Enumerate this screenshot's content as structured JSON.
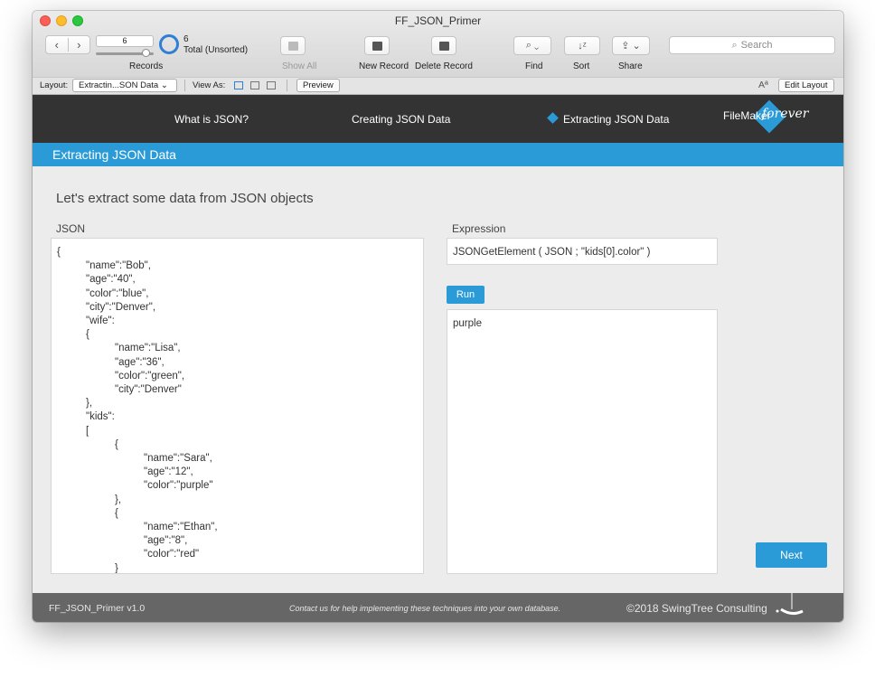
{
  "window": {
    "title": "FF_JSON_Primer"
  },
  "toolbar": {
    "record_number": "6",
    "records_label": "Records",
    "found_count": "6",
    "found_total": "Total (Unsorted)",
    "show_all": "Show All",
    "new_record": "New Record",
    "delete_record": "Delete Record",
    "find": "Find",
    "sort": "Sort",
    "share": "Share",
    "search_placeholder": "Search"
  },
  "layout_bar": {
    "layout_label": "Layout:",
    "layout_value": "Extractin...SON Data",
    "view_as_label": "View As:",
    "preview": "Preview",
    "edit_layout": "Edit Layout",
    "font_size_icon": "Aª"
  },
  "nav": {
    "items": [
      {
        "label": "What is JSON?"
      },
      {
        "label": "Creating JSON Data"
      },
      {
        "label": "Extracting JSON Data"
      }
    ],
    "logo_text": "FileMaker",
    "logo_script": "forever"
  },
  "section": {
    "title": "Extracting JSON Data"
  },
  "main": {
    "heading": "Let's extract some data from JSON objects",
    "json_label": "JSON",
    "json_text": "{\n\t\"name\":\"Bob\",\n\t\"age\":\"40\",\n\t\"color\":\"blue\",\n\t\"city\":\"Denver\",\n\t\"wife\":\n\t{\n\t\t\"name\":\"Lisa\",\n\t\t\"age\":\"36\",\n\t\t\"color\":\"green\",\n\t\t\"city\":\"Denver\"\n\t},\n\t\"kids\":\n\t[\n\t\t{\n\t\t\t\"name\":\"Sara\",\n\t\t\t\"age\":\"12\",\n\t\t\t\"color\":\"purple\"\n\t\t},\n\t\t{\n\t\t\t\"name\":\"Ethan\",\n\t\t\t\"age\":\"8\",\n\t\t\t\"color\":\"red\"\n\t\t}",
    "expression_label": "Expression",
    "expression_value": "JSONGetElement ( JSON ; \"kids[0].color\" )",
    "run_label": "Run",
    "result_value": "purple",
    "next_label": "Next"
  },
  "footer": {
    "version": "FF_JSON_Primer v1.0",
    "contact": "Contact us for help implementing these techniques into your own database.",
    "copyright": "©2018  SwingTree Consulting"
  },
  "colors": {
    "accent": "#2b9bd8",
    "nav_bg": "#333333",
    "footer_bg": "#666666"
  }
}
